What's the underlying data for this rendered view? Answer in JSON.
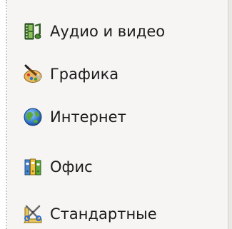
{
  "menu": {
    "items": [
      {
        "label": "Аудио и видео",
        "icon": "audio-video-icon"
      },
      {
        "label": "Графика",
        "icon": "graphics-icon"
      },
      {
        "label": "Интернет",
        "icon": "internet-globe-icon"
      },
      {
        "label": "Офис",
        "icon": "office-binders-icon"
      },
      {
        "label": "Стандартные",
        "icon": "accessories-tools-icon"
      }
    ]
  }
}
